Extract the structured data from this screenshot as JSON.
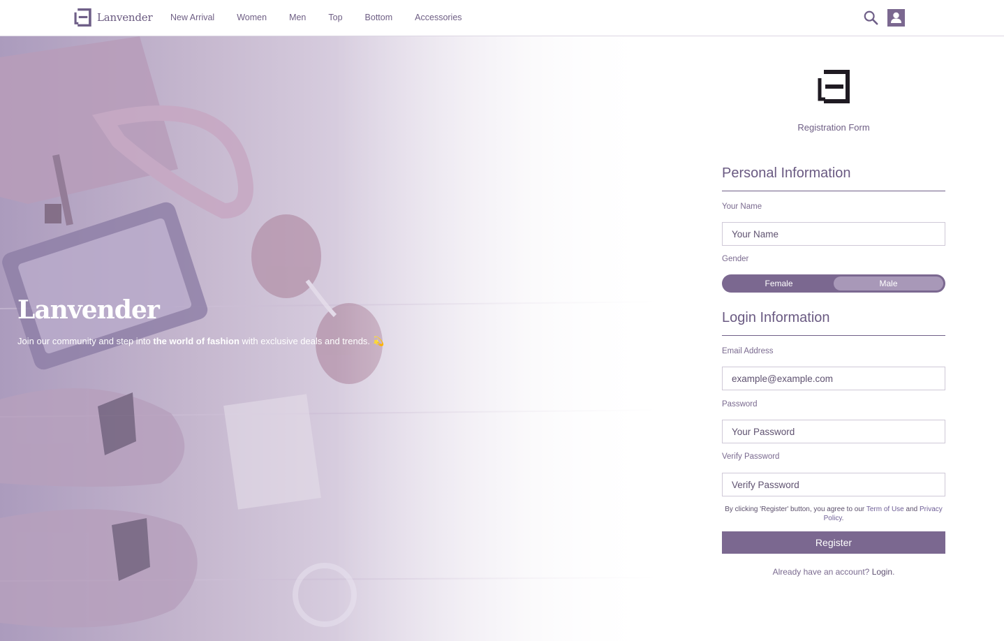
{
  "nav": {
    "brand": "Lanvender",
    "links": [
      "New Arrival",
      "Women",
      "Men",
      "Top",
      "Bottom",
      "Accessories"
    ],
    "icons": [
      "logo-icon",
      "search-icon",
      "user-icon"
    ]
  },
  "hero": {
    "title": "Lanvender",
    "tagline_before": "Join our community and step into ",
    "tagline_bold": "the world of fashion",
    "tagline_after": " with exclusive deals and trends.",
    "tagline_emoji": "💫"
  },
  "form": {
    "subtitle": "Registration Form",
    "personal_title": "Personal Information",
    "name_label": "Your Name",
    "name_placeholder": "Your Name",
    "gender_label": "Gender",
    "gender_options": [
      "Female",
      "Male"
    ],
    "gender_selected": "Female",
    "login_title": "Login Information",
    "email_label": "Email Address",
    "email_placeholder": "example@example.com",
    "password_label": "Password",
    "password_placeholder": "Your Password",
    "verify_label": "Verify Password",
    "verify_placeholder": "Verify Password",
    "terms_prefix": "By clicking 'Register' button, you agree to our ",
    "terms_link": "Term of Use",
    "terms_mid": " and ",
    "privacy_link": "Privacy Policy",
    "terms_suffix": ".",
    "register_button": "Register",
    "login_prompt": "Already have an account? ",
    "login_link": "Login",
    "login_suffix": "."
  },
  "colors": {
    "accent": "#7b6890",
    "text": "#6e5e84",
    "sparkle": "#f4b63d"
  }
}
